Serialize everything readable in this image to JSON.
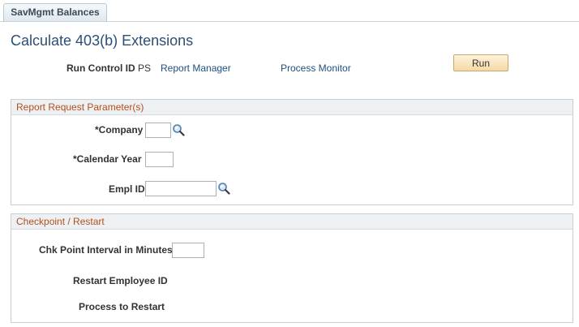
{
  "tab": {
    "label": "SavMgmt Balances"
  },
  "page": {
    "title": "Calculate 403(b) Extensions"
  },
  "run_control": {
    "label": "Run Control ID",
    "value": "PS",
    "report_manager": "Report Manager",
    "process_monitor": "Process Monitor",
    "run_button": "Run"
  },
  "report_params": {
    "header": "Report Request Parameter(s)",
    "company_label": "*Company",
    "company_value": "",
    "calendar_year_label": "*Calendar Year",
    "calendar_year_value": "",
    "empl_id_label": "Empl ID",
    "empl_id_value": ""
  },
  "checkpoint": {
    "header": "Checkpoint / Restart",
    "interval_label": "Chk Point Interval in Minutes",
    "interval_value": "",
    "restart_employee_label": "Restart Employee ID",
    "process_restart_label": "Process to Restart"
  },
  "icons": {
    "lookup": "magnifier-icon"
  },
  "colors": {
    "title": "#2b4f76",
    "link": "#1f4f82",
    "group_header_text": "#b54e1a",
    "run_button": "#f5d9a5"
  }
}
